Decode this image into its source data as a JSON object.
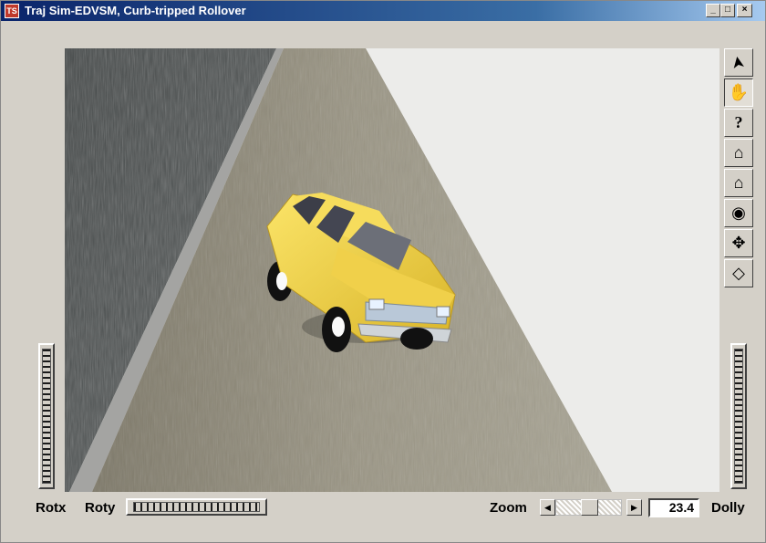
{
  "window": {
    "title": "Traj Sim-EDVSM, Curb-tripped Rollover",
    "app_icon_label": "TS",
    "minimize": "_",
    "maximize": "□",
    "close": "×"
  },
  "toolbar": {
    "tools": [
      {
        "name": "select-arrow-icon",
        "glyph": "➤"
      },
      {
        "name": "pan-hand-icon",
        "glyph": "✋"
      },
      {
        "name": "help-icon",
        "glyph": "?"
      },
      {
        "name": "home-icon",
        "glyph": "⌂"
      },
      {
        "name": "set-home-icon",
        "glyph": "⌂"
      },
      {
        "name": "view-all-eye-icon",
        "glyph": "◉"
      },
      {
        "name": "seek-target-icon",
        "glyph": "✥"
      },
      {
        "name": "perspective-icon",
        "glyph": "◇"
      }
    ],
    "active_tool": "pan-hand-icon"
  },
  "controls": {
    "rotx_label": "Rotx",
    "roty_label": "Roty",
    "zoom_label": "Zoom",
    "zoom_value": "23.4",
    "dolly_label": "Dolly",
    "zoom_left_arrow": "◀",
    "zoom_right_arrow": "▶"
  },
  "scene": {
    "vehicle_color": "#f2d43c",
    "road_color": "#8f8a78",
    "water_color": "#4e5252",
    "sky_color": "#ececea"
  }
}
